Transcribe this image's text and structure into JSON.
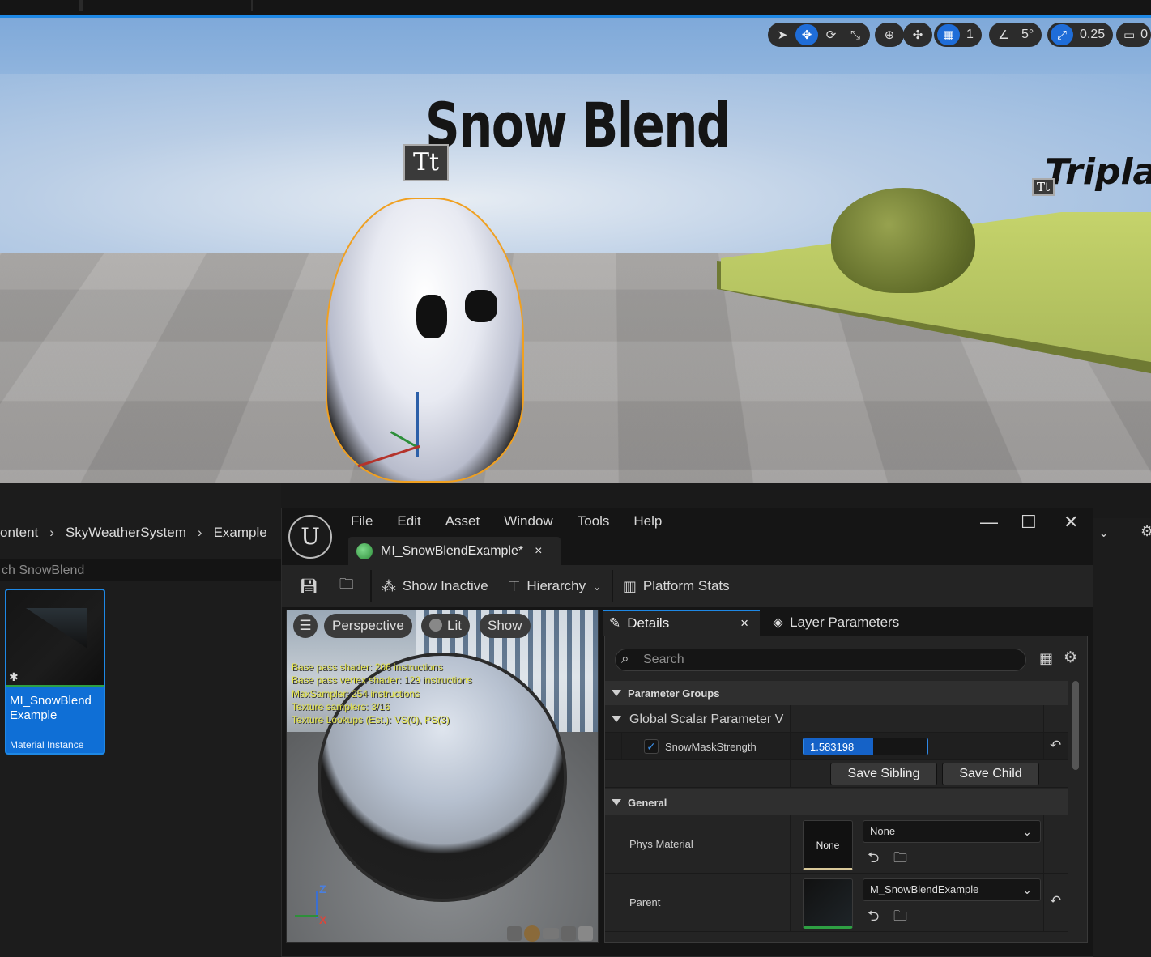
{
  "viewport": {
    "text_primary": "Snow Blend",
    "text_secondary": "Tripla",
    "text_icon_label": "Tt",
    "toolbar": {
      "grid_snap_value": "1",
      "rotation_snap_value": "5°",
      "scale_snap_value": "0.25",
      "camera_speed_value": "0"
    }
  },
  "content_browser": {
    "breadcrumb": [
      "ontent",
      "SkyWeatherSystem",
      "Example"
    ],
    "search_text": "ch SnowBlend",
    "asset": {
      "name": "MI_SnowBlend Example",
      "type": "Material Instance"
    }
  },
  "material_editor": {
    "menu": [
      "File",
      "Edit",
      "Asset",
      "Window",
      "Tools",
      "Help"
    ],
    "window_controls": {
      "minimize": "—",
      "maximize": "☐",
      "close": "✕"
    },
    "tab_title": "MI_SnowBlendExample*",
    "tab_close": "×",
    "toolbar": {
      "show_inactive": "Show Inactive",
      "hierarchy": "Hierarchy",
      "platform_stats": "Platform Stats"
    },
    "preview": {
      "mode": "Perspective",
      "lit": "Lit",
      "show": "Show",
      "stats": [
        "Base pass shader: 206 instructions",
        "Base pass vertex shader: 129 instructions",
        "MaxSampler: 254 instructions",
        "Texture samplers: 3/16",
        "Texture Lookups (Est.): VS(0), PS(3)"
      ],
      "axis_z": "Z",
      "axis_x": "X"
    },
    "details": {
      "tab_details": "Details",
      "tab_details_close": "×",
      "tab_layer": "Layer Parameters",
      "search_placeholder": "Search",
      "section_parameter_groups": "Parameter Groups",
      "group_global_scalar": "Global Scalar Parameter V",
      "param_name": "SnowMaskStrength",
      "param_enabled": true,
      "param_value": "1.583198",
      "param_fill_fraction": 0.56,
      "save_sibling": "Save Sibling",
      "save_child": "Save Child",
      "section_general": "General",
      "phys_material_label": "Phys Material",
      "phys_material_thumb": "None",
      "phys_material_value": "None",
      "parent_label": "Parent",
      "parent_value": "M_SnowBlendExample"
    }
  },
  "colors": {
    "accent": "#1e88e5",
    "selection_outline": "#f0a020",
    "stats_text": "#e5e54a"
  }
}
